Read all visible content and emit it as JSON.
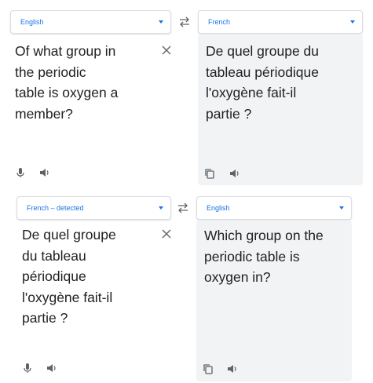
{
  "top": {
    "source_lang": "English",
    "target_lang": "French",
    "source_text": [
      "Of what group in",
      "the periodic",
      "table is oxygen a",
      "member?"
    ],
    "target_text": [
      "De quel groupe du",
      "tableau périodique",
      "l'oxygène fait-il",
      "partie ?"
    ]
  },
  "bottom": {
    "source_lang": "French – detected",
    "target_lang": "English",
    "source_text": [
      "De quel groupe",
      "du tableau",
      "périodique",
      "l'oxygène fait-il",
      "partie ?"
    ],
    "target_text": [
      "Which group on the",
      "periodic table is",
      "oxygen in?"
    ]
  },
  "icons": {
    "swap": "swap-languages-icon",
    "clear": "close-icon",
    "mic": "microphone-icon",
    "speaker": "speaker-icon",
    "copy": "copy-icon"
  }
}
